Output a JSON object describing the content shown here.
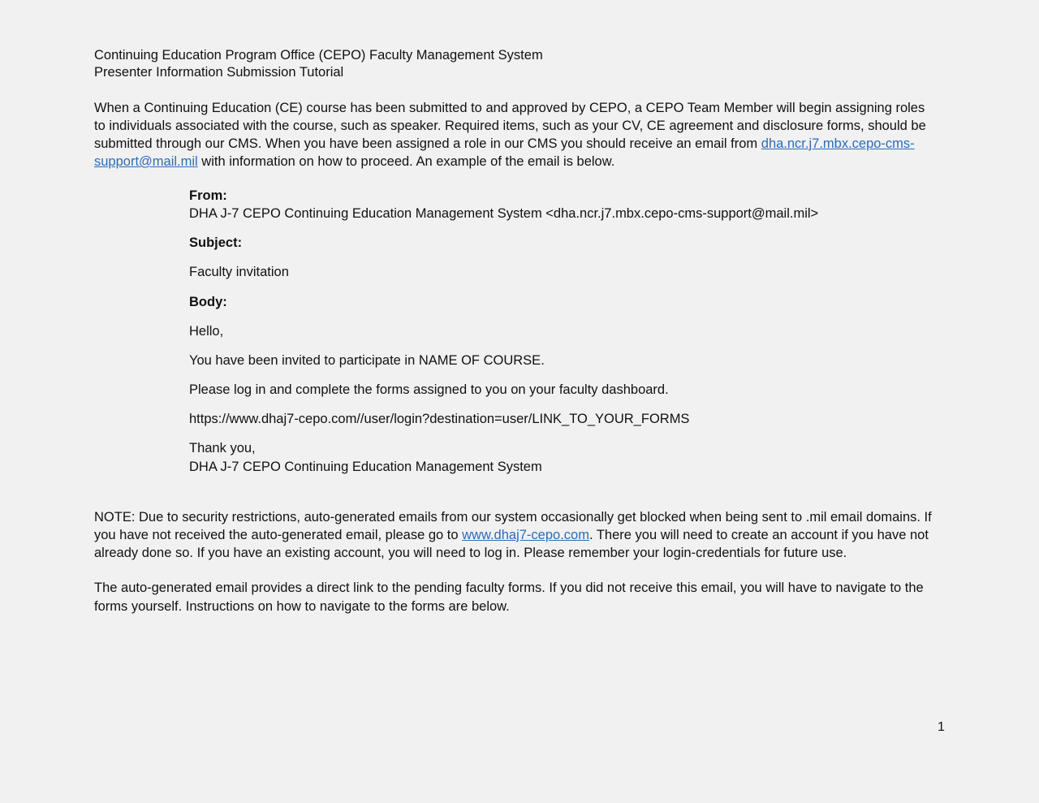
{
  "header": {
    "title_line1": "Continuing Education Program Office (CEPO) Faculty Management System",
    "title_line2": "Presenter Information Submission Tutorial"
  },
  "intro": {
    "text_before_link": "When a Continuing Education (CE) course has been submitted to and approved by CEPO, a CEPO Team Member will begin assigning roles to individuals associated with the course, such as speaker.  Required items, such as your CV, CE agreement and disclosure forms, should be submitted through our CMS.  When you have been assigned a role in our CMS you should receive an email from ",
    "email_link": "dha.ncr.j7.mbx.cepo-cms-support@mail.mil",
    "text_after_link": " with information on how to proceed. An example of the email is below."
  },
  "email_example": {
    "from_label": "From:",
    "from_value": "DHA J-7 CEPO Continuing Education Management System <dha.ncr.j7.mbx.cepo-cms-support@mail.mil>",
    "subject_label": "Subject:",
    "subject_value": "Faculty invitation",
    "body_label": "Body:",
    "greeting": "Hello,",
    "invite_line": "You have been invited to participate in NAME OF COURSE.",
    "instruction_line": "Please log in and complete the forms assigned to you on your faculty dashboard.",
    "link_line": "https://www.dhaj7-cepo.com//user/login?destination=user/LINK_TO_YOUR_FORMS",
    "signoff": "Thank you,",
    "signature": "DHA J-7 CEPO Continuing Education Management System"
  },
  "note": {
    "text_before_link": "NOTE: Due to security restrictions, auto-generated emails from our system occasionally get blocked when being sent to .mil email domains. If you have not received the auto-generated email, please go to ",
    "site_link": "www.dhaj7-cepo.com",
    "text_after_link": ".  There you will need to create an account if you have not already done so. If you have an existing account, you will need to log in.  Please remember your login-credentials for future use."
  },
  "auto_email_paragraph": "The auto-generated email provides a direct link to the pending faculty forms. If you did not receive this email, you will have to navigate to the forms yourself.  Instructions on how to navigate to the forms are below.",
  "page_number": "1",
  "colors": {
    "link": "#2a6cb8",
    "background": "#f1f1f2",
    "text": "#111111"
  }
}
